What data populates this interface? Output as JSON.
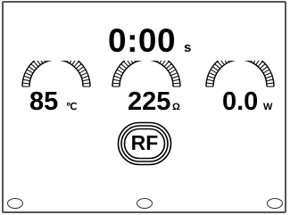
{
  "timer": {
    "value": "0:00",
    "unit": "s"
  },
  "gauges": [
    {
      "value": "85",
      "unit": "℃",
      "icon": "arc-gauge-icon"
    },
    {
      "value": "225",
      "unit": "Ω",
      "icon": "arc-gauge-icon"
    },
    {
      "value": "0.0",
      "unit": "W",
      "icon": "arc-gauge-icon"
    }
  ],
  "rf_button": {
    "label": "RF"
  },
  "colors": {
    "background": "#ffffff",
    "foreground": "#000000",
    "frame": "#555555"
  }
}
